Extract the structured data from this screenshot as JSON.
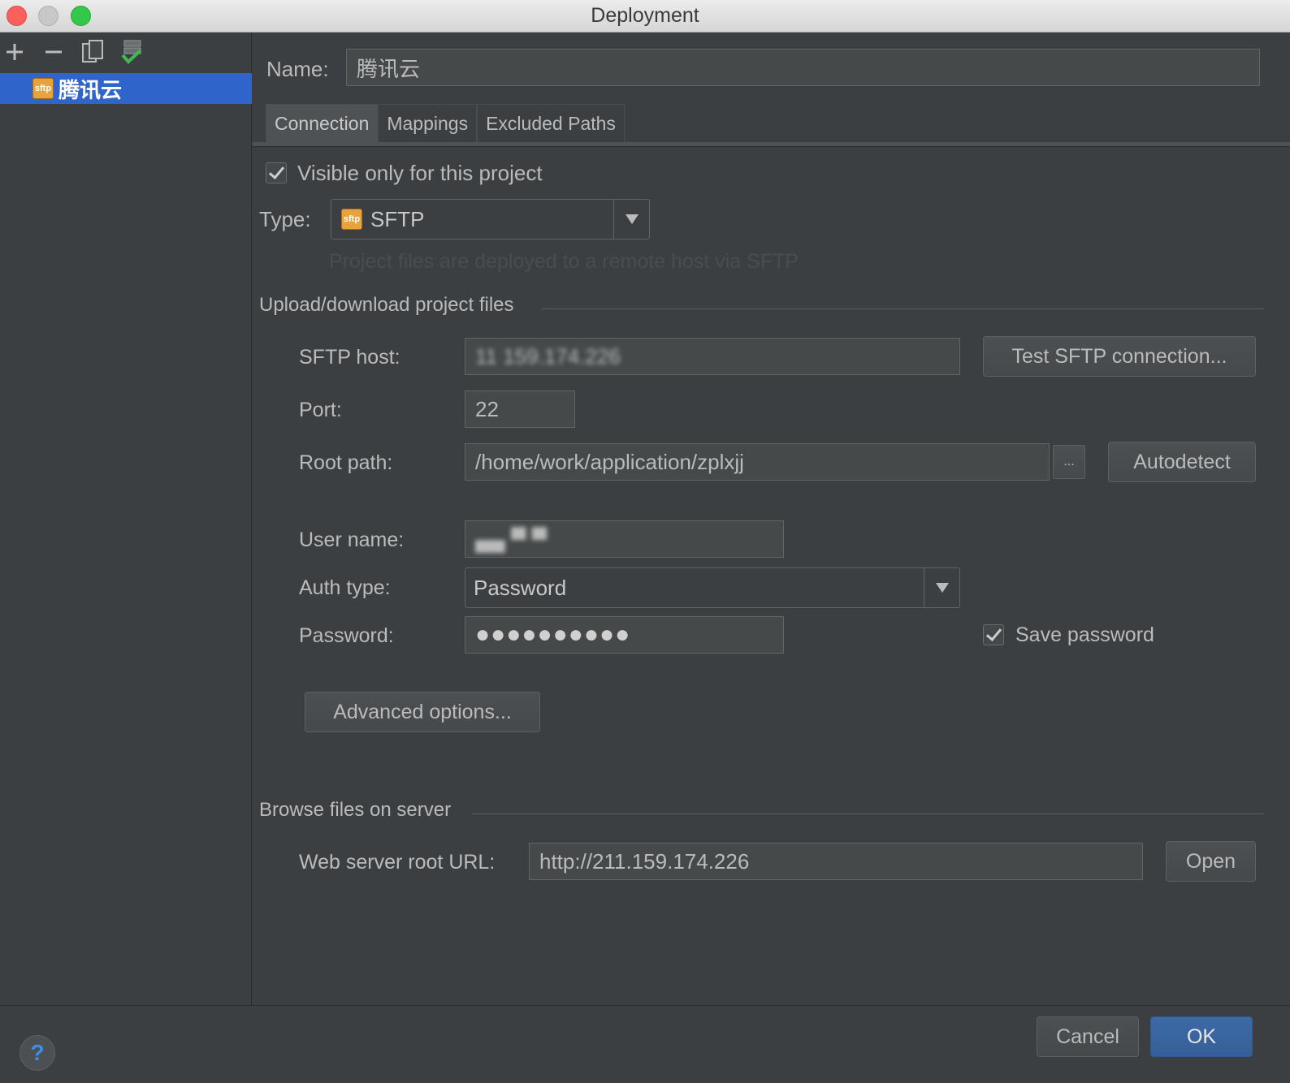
{
  "window": {
    "title": "Deployment"
  },
  "sidebar": {
    "toolbar": [
      {
        "icon": "plus-icon"
      },
      {
        "icon": "minus-icon"
      },
      {
        "icon": "copy-icon"
      },
      {
        "icon": "set-default-icon"
      }
    ],
    "servers": [
      {
        "label": "腾讯云",
        "icon": "sftp-icon",
        "badge": "sftp"
      }
    ]
  },
  "form": {
    "name_label": "Name:",
    "name_value": "腾讯云",
    "tabs": [
      {
        "label": "Connection",
        "active": true
      },
      {
        "label": "Mappings",
        "active": false
      },
      {
        "label": "Excluded Paths",
        "active": false
      }
    ],
    "visible_only_label": "Visible only for this project",
    "visible_only_checked": true,
    "type_label": "Type:",
    "type_value": "SFTP",
    "type_badge": "sftp",
    "type_hint": "Project files are deployed to a remote host via SFTP",
    "upload_section": "Upload/download project files",
    "sftp_host_label": "SFTP host:",
    "sftp_host_value": "11 159.174.226",
    "test_button": "Test SFTP connection...",
    "port_label": "Port:",
    "port_value": "22",
    "root_path_label": "Root path:",
    "root_path_value": "/home/work/application/zplxjj",
    "browse_button": "...",
    "autodetect_button": "Autodetect",
    "user_name_label": "User name:",
    "user_name_value": "▄▄ ▀ ▀",
    "auth_type_label": "Auth type:",
    "auth_type_value": "Password",
    "password_label": "Password:",
    "password_value": "●●●●●●●●●●",
    "save_password_label": "Save password",
    "save_password_checked": true,
    "advanced_button": "Advanced options...",
    "browse_section": "Browse files on server",
    "web_root_label": "Web server root URL:",
    "web_root_value": "http://211.159.174.226",
    "open_button": "Open"
  },
  "footer": {
    "help_label": "?",
    "cancel_button": "Cancel",
    "ok_button": "OK"
  },
  "colors": {
    "background": "#3c3f41",
    "selection": "#2f65ca",
    "field": "#45494a",
    "ok_button": "#365f96",
    "sftp_badge": "#e8a33d"
  }
}
